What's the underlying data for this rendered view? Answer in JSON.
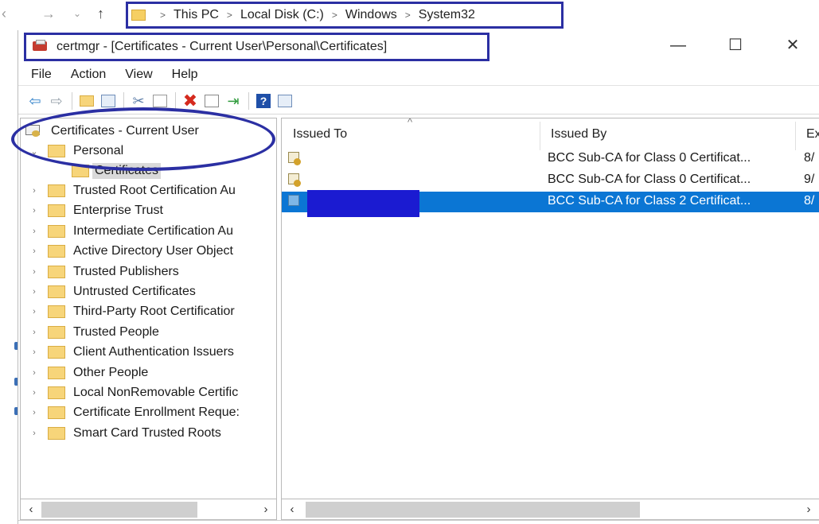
{
  "explorer": {
    "breadcrumb": [
      "This PC",
      "Local Disk (C:)",
      "Windows",
      "System32"
    ],
    "separator": ">"
  },
  "window": {
    "title": "certmgr - [Certificates - Current User\\Personal\\Certificates]",
    "controls": {
      "minimize": "—",
      "maximize": "☐",
      "close": "✕"
    }
  },
  "menu": [
    "File",
    "Action",
    "View",
    "Help"
  ],
  "toolbar": {
    "icons": [
      "back-icon",
      "forward-icon",
      "up-folder-icon",
      "show-hide-tree-icon",
      "cut-icon",
      "copy-icon",
      "delete-icon",
      "properties-icon",
      "export-icon",
      "help-icon",
      "console-icon"
    ],
    "back": "⇦",
    "forward": "⇨",
    "cut": "✂",
    "delete": "✖",
    "export": "⇥",
    "help": "?"
  },
  "tree": {
    "root": "Certificates - Current User",
    "expanded_open": "⌄",
    "collapsed": "›",
    "personal": "Personal",
    "personal_child": "Certificates",
    "items": [
      "Trusted Root Certification Au",
      "Enterprise Trust",
      "Intermediate Certification Au",
      "Active Directory User Object",
      "Trusted Publishers",
      "Untrusted Certificates",
      "Third-Party Root Certificatior",
      "Trusted People",
      "Client Authentication Issuers",
      "Other People",
      "Local NonRemovable Certific",
      "Certificate Enrollment Reque:",
      "Smart Card Trusted Roots"
    ]
  },
  "list": {
    "columns": {
      "issued_to": "Issued To",
      "issued_by": "Issued By",
      "expiration": "Ex"
    },
    "sort_indicator": "^",
    "rows": [
      {
        "issued_to": "",
        "issued_by": "BCC Sub-CA for Class 0 Certificat...",
        "exp": "8/",
        "selected": false
      },
      {
        "issued_to": "",
        "issued_by": "BCC Sub-CA for Class 0 Certificat...",
        "exp": "9/",
        "selected": false
      },
      {
        "issued_to": "",
        "issued_by": "BCC Sub-CA for Class 2 Certificat...",
        "exp": "8/",
        "selected": true
      }
    ]
  },
  "scroll": {
    "left": "‹",
    "right": "›"
  },
  "colors": {
    "annotation": "#2b2fa3",
    "selection": "#0b76d4",
    "redaction": "#1b1bd1"
  }
}
